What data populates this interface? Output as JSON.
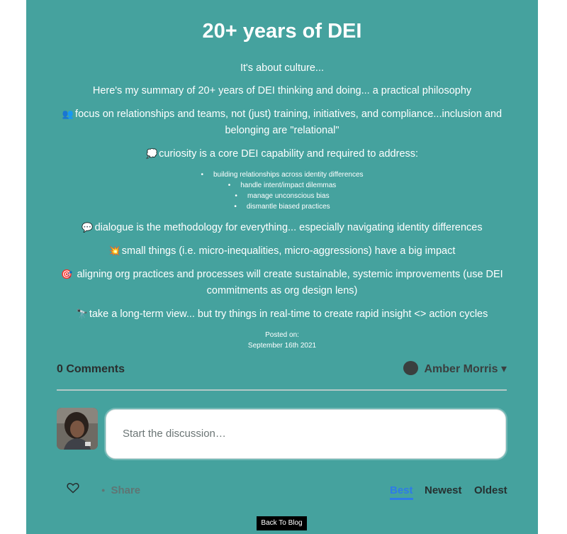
{
  "post": {
    "title": "20+ years of DEI",
    "subtitle": "It's about culture...",
    "intro": "Here's my summary of 20+ years of DEI thinking and doing... a practical philosophy",
    "point_relationships": {
      "emoji": "👥",
      "text": "focus on relationships and teams, not (just) training, initiatives, and compliance...inclusion and belonging are \"relational\""
    },
    "point_curiosity": {
      "emoji": "💭",
      "text": "curiosity is a core DEI capability and required to address:"
    },
    "bullets": [
      "building relationships across identity differences",
      "handle intent/impact dilemmas",
      "manage unconscious bias",
      "dismantle biased practices"
    ],
    "point_dialogue": {
      "emoji": "💬",
      "text": "dialogue is the methodology for everything... especially navigating identity differences"
    },
    "point_small": {
      "emoji": "💥",
      "text": "small things (i.e. micro-inequalities, micro-aggressions) have a big impact"
    },
    "point_align": {
      "emoji": "🎯",
      "text": " aligning org practices and processes will create sustainable, systemic improvements (use DEI commitments as org design lens)"
    },
    "point_longterm": {
      "emoji": "🔭",
      "text": "take a long-term view... but try things in real-time to create rapid insight <> action cycles"
    },
    "posted_label": "Posted on:",
    "posted_date": "September 16th 2021"
  },
  "comments": {
    "count_label": "0 Comments",
    "user_name": "Amber Morris",
    "user_caret": "▾",
    "reply_placeholder": "Start the discussion…",
    "share_label": "Share",
    "sort_best": "Best",
    "sort_newest": "Newest",
    "sort_oldest": "Oldest"
  },
  "footer": {
    "back_label": "Back To Blog"
  },
  "colors": {
    "panel": "#45a29e",
    "accent": "#2e7be8",
    "back_button": "#000000"
  }
}
